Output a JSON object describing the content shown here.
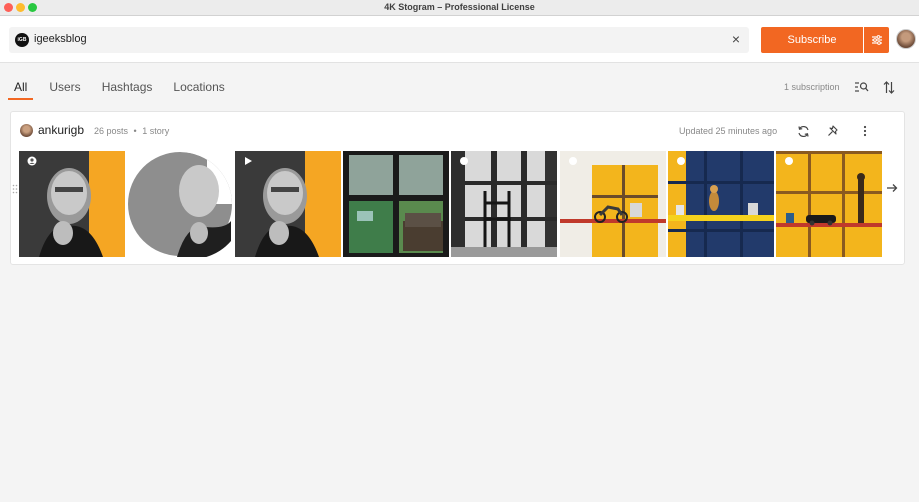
{
  "window": {
    "title": "4K Stogram – Professional License"
  },
  "search": {
    "value": "igeeksblog",
    "avatar_text": "iGB",
    "clear_icon": "close-icon"
  },
  "header": {
    "subscribe_label": "Subscribe",
    "settings_icon": "sliders-icon"
  },
  "tabs": [
    {
      "label": "All",
      "active": true
    },
    {
      "label": "Users",
      "active": false
    },
    {
      "label": "Hashtags",
      "active": false
    },
    {
      "label": "Locations",
      "active": false
    }
  ],
  "toolbar": {
    "subscription_count": "1 subscription",
    "filter_icon": "filter-search-icon",
    "sort_icon": "sort-icon"
  },
  "subscription": {
    "username": "ankurigb",
    "posts": "26 posts",
    "separator": "•",
    "stories": "1 story",
    "updated": "Updated 25 minutes ago",
    "icons": [
      "refresh-icon",
      "pin-icon",
      "more-vertical-icon"
    ],
    "thumbnails": [
      {
        "subject": "portrait-poster",
        "badge": "user-icon"
      },
      {
        "subject": "story-circle",
        "badge": ""
      },
      {
        "subject": "portrait-poster",
        "badge": "play-icon"
      },
      {
        "subject": "window-city-view",
        "badge": ""
      },
      {
        "subject": "chair-window-bw",
        "badge": "dot-icon"
      },
      {
        "subject": "shelf-motorbike",
        "badge": "dot-icon"
      },
      {
        "subject": "shelf-figurines",
        "badge": "dot-icon"
      },
      {
        "subject": "shelf-car",
        "badge": "dot-icon"
      }
    ]
  },
  "colors": {
    "accent": "#f26722",
    "background": "#f4f4f4",
    "card": "#ffffff",
    "muted_text": "#888888"
  }
}
